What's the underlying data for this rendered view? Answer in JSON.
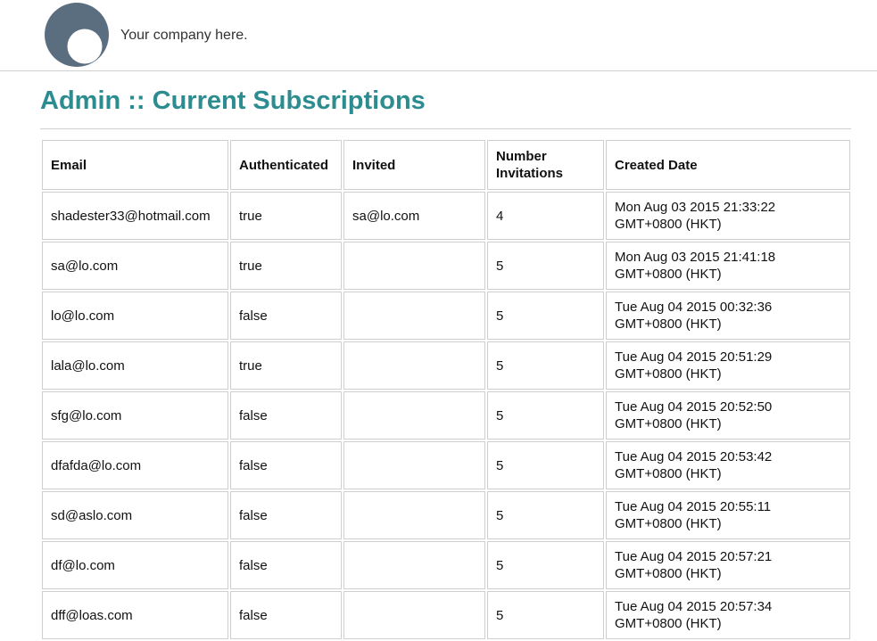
{
  "header": {
    "company_text": "Your company here."
  },
  "page": {
    "title": "Admin :: Current Subscriptions"
  },
  "table": {
    "columns": [
      "Email",
      "Authenticated",
      "Invited",
      "Number Invitations",
      "Created Date"
    ],
    "rows": [
      {
        "email": "shadester33@hotmail.com",
        "authenticated": "true",
        "invited": "sa@lo.com",
        "number_invitations": "4",
        "created_date": "Mon Aug 03 2015 21:33:22 GMT+0800 (HKT)"
      },
      {
        "email": "sa@lo.com",
        "authenticated": "true",
        "invited": "",
        "number_invitations": "5",
        "created_date": "Mon Aug 03 2015 21:41:18 GMT+0800 (HKT)"
      },
      {
        "email": "lo@lo.com",
        "authenticated": "false",
        "invited": "",
        "number_invitations": "5",
        "created_date": "Tue Aug 04 2015 00:32:36 GMT+0800 (HKT)"
      },
      {
        "email": "lala@lo.com",
        "authenticated": "true",
        "invited": "",
        "number_invitations": "5",
        "created_date": "Tue Aug 04 2015 20:51:29 GMT+0800 (HKT)"
      },
      {
        "email": "sfg@lo.com",
        "authenticated": "false",
        "invited": "",
        "number_invitations": "5",
        "created_date": "Tue Aug 04 2015 20:52:50 GMT+0800 (HKT)"
      },
      {
        "email": "dfafda@lo.com",
        "authenticated": "false",
        "invited": "",
        "number_invitations": "5",
        "created_date": "Tue Aug 04 2015 20:53:42 GMT+0800 (HKT)"
      },
      {
        "email": "sd@aslo.com",
        "authenticated": "false",
        "invited": "",
        "number_invitations": "5",
        "created_date": "Tue Aug 04 2015 20:55:11 GMT+0800 (HKT)"
      },
      {
        "email": "df@lo.com",
        "authenticated": "false",
        "invited": "",
        "number_invitations": "5",
        "created_date": "Tue Aug 04 2015 20:57:21 GMT+0800 (HKT)"
      },
      {
        "email": "dff@loas.com",
        "authenticated": "false",
        "invited": "",
        "number_invitations": "5",
        "created_date": "Tue Aug 04 2015 20:57:34 GMT+0800 (HKT)"
      }
    ]
  },
  "colors": {
    "title": "#2c8c8f",
    "logo": "#5b6e80",
    "border": "#cfcfcf"
  },
  "icons": {
    "logo": "company-logo-icon"
  }
}
